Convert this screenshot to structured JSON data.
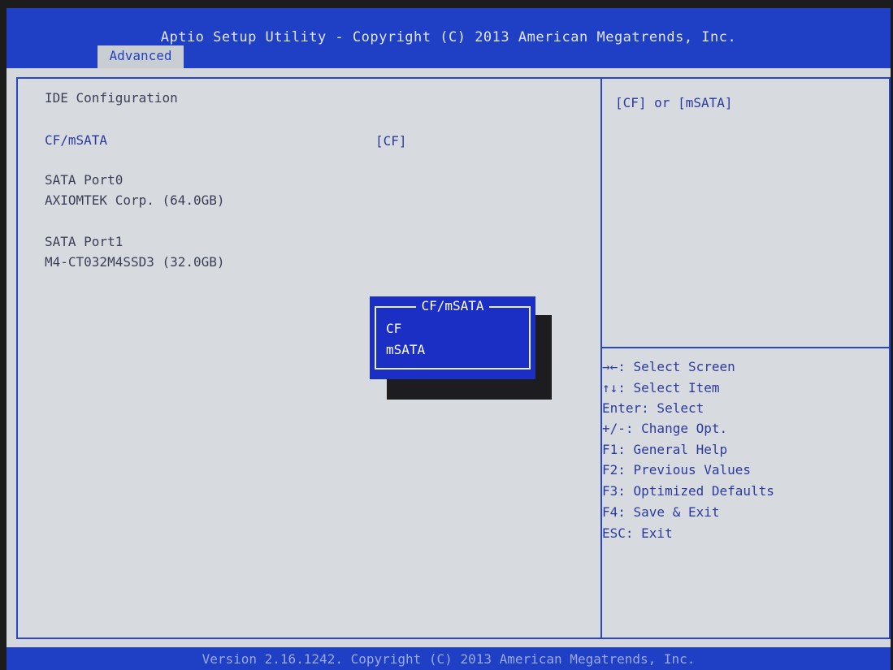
{
  "header": {
    "title": "Aptio Setup Utility - Copyright (C) 2013 American Megatrends, Inc.",
    "tab": "Advanced"
  },
  "left": {
    "section_title": "IDE Configuration",
    "setting_label": "CF/mSATA",
    "setting_value": "[CF]",
    "port0_label": "SATA Port0",
    "port0_device": "AXIOMTEK Corp. (64.0GB)",
    "port1_label": "SATA Port1",
    "port1_device": "M4-CT032M4SSD3 (32.0GB)"
  },
  "popup": {
    "title": "CF/mSATA",
    "options": [
      "CF",
      "mSATA"
    ],
    "selected_index": 1
  },
  "help": {
    "description": "[CF] or [mSATA]",
    "keys": [
      "→←: Select Screen",
      "↑↓: Select Item",
      "Enter: Select",
      "+/-: Change Opt.",
      "F1: General Help",
      "F2: Previous Values",
      "F3: Optimized Defaults",
      "F4: Save & Exit",
      "ESC: Exit"
    ]
  },
  "footer": {
    "text": "Version 2.16.1242. Copyright (C) 2013 American Megatrends, Inc."
  },
  "colors": {
    "bios_blue": "#1f3fc4",
    "panel_gray": "#d7dbdf",
    "popup_blue": "#1b2fc4"
  }
}
